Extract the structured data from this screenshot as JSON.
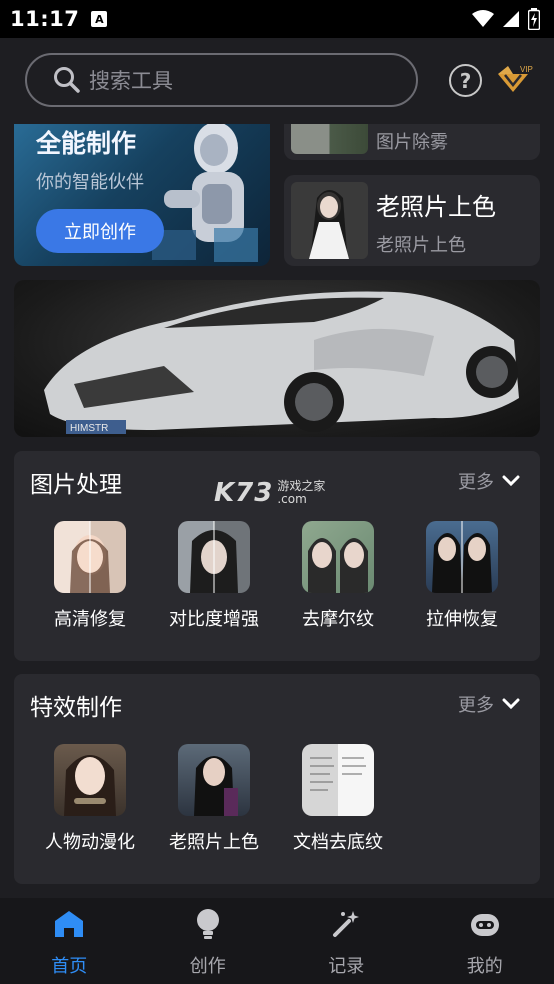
{
  "status_bar": {
    "time": "11:17",
    "notif_icon": "A"
  },
  "header": {
    "search_placeholder": "搜索工具",
    "vip_badge": "VIP"
  },
  "banner_ai": {
    "title": "全能制作",
    "subtitle": "你的智能伙伴",
    "button": "立即创作"
  },
  "side_cards": [
    {
      "title": "",
      "subtitle": "图片除雾"
    },
    {
      "title": "老照片上色",
      "subtitle": "老照片上色"
    }
  ],
  "car_banner": {
    "plate": "HIMSTR"
  },
  "watermark": {
    "main": "K73",
    "line1": "游戏之家",
    "line2": ".com"
  },
  "section_image": {
    "title": "图片处理",
    "more": "更多",
    "tools": [
      "高清修复",
      "对比度增强",
      "去摩尔纹",
      "拉伸恢复"
    ]
  },
  "section_effects": {
    "title": "特效制作",
    "more": "更多",
    "tools": [
      "人物动漫化",
      "老照片上色",
      "文档去底纹"
    ]
  },
  "bottom_nav": [
    {
      "label": "首页",
      "icon": "home-icon",
      "active": true
    },
    {
      "label": "创作",
      "icon": "lightbulb-icon",
      "active": false
    },
    {
      "label": "记录",
      "icon": "magic-wand-icon",
      "active": false
    },
    {
      "label": "我的",
      "icon": "robot-face-icon",
      "active": false
    }
  ],
  "colors": {
    "accent": "#2f8df5",
    "button_blue": "#3a78e6",
    "card_bg": "#2a2a2f",
    "page_bg": "#1e1e22"
  }
}
